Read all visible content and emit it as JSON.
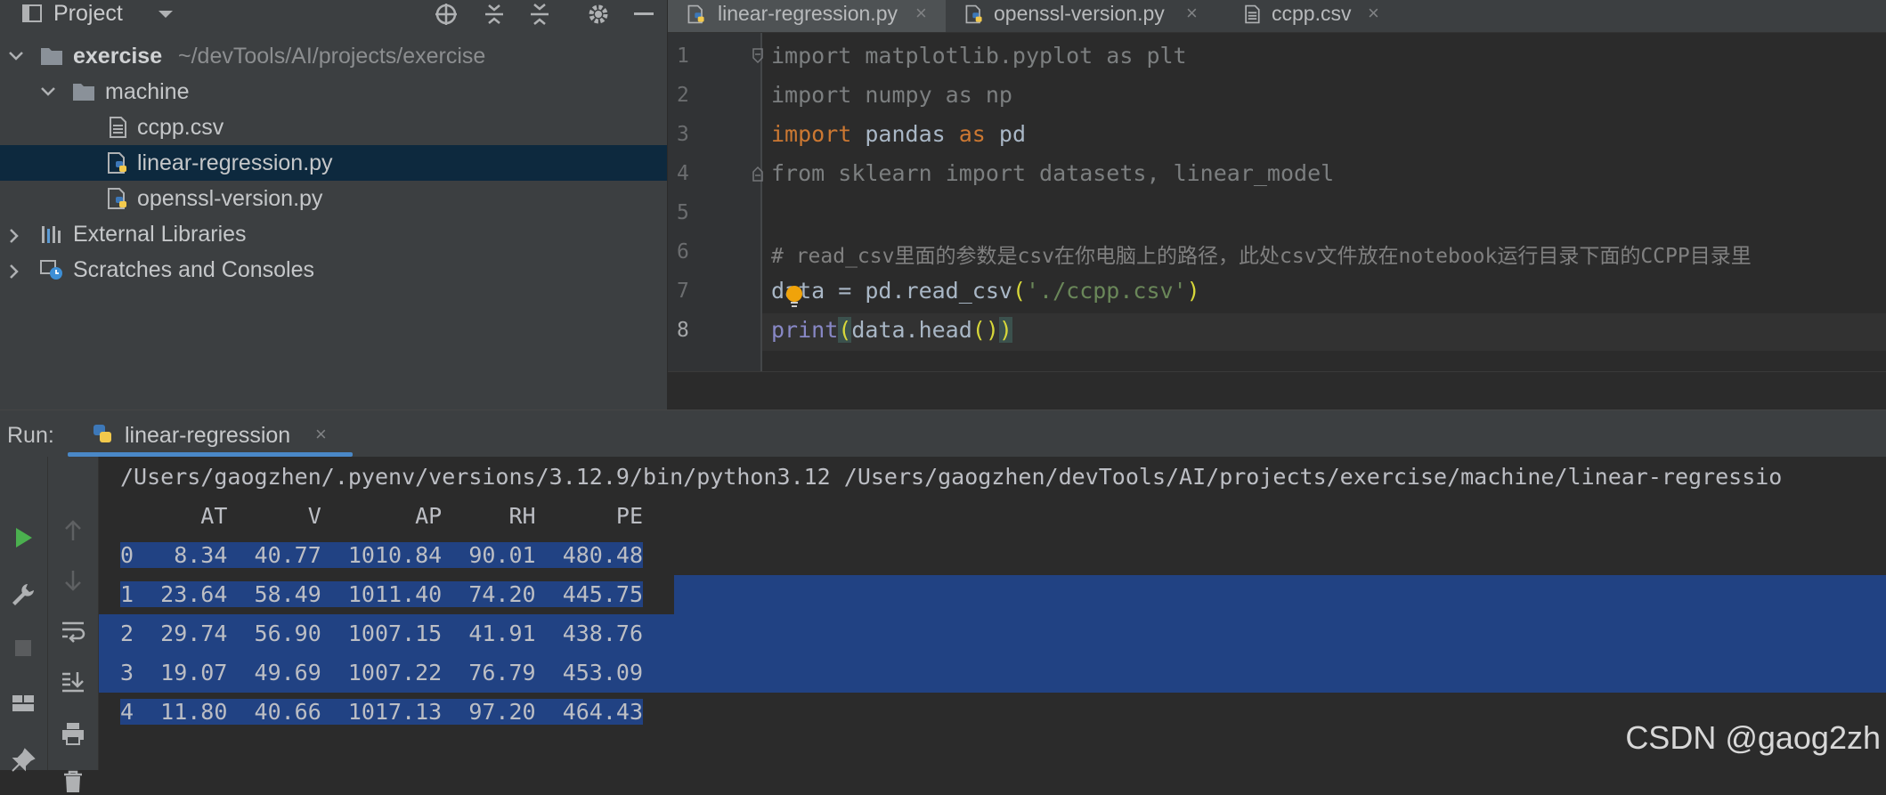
{
  "project": {
    "title": "Project",
    "tree": [
      {
        "label": "exercise",
        "path": "~/devTools/AI/projects/exercise"
      },
      {
        "label": "machine"
      },
      {
        "label": "ccpp.csv"
      },
      {
        "label": "linear-regression.py"
      },
      {
        "label": "openssl-version.py"
      },
      {
        "label": "External Libraries"
      },
      {
        "label": "Scratches and Consoles"
      }
    ]
  },
  "editor": {
    "tabs": [
      {
        "label": "linear-regression.py",
        "close": "×"
      },
      {
        "label": "openssl-version.py",
        "close": "×"
      },
      {
        "label": "ccpp.csv",
        "close": "×"
      }
    ],
    "line_numbers": [
      "1",
      "2",
      "3",
      "4",
      "5",
      "6",
      "7",
      "8"
    ],
    "code": {
      "l1_kw": "import",
      "l1_rest": " matplotlib.pyplot ",
      "l1_as": "as",
      "l1_alias": " plt",
      "l2_kw": "import",
      "l2_rest": " numpy ",
      "l2_as": "as",
      "l2_alias": " np",
      "l3_kw": "import",
      "l3_rest": " pandas ",
      "l3_as": "as",
      "l3_alias": " pd",
      "l4_kw": "from",
      "l4_mod": " sklearn ",
      "l4_imp": "import",
      "l4_rest": " datasets, linear_model",
      "l6": "# read_csv里面的参数是csv在你电脑上的路径，此处csv文件放在notebook运行目录下面的CCPP目录里",
      "l7_a": "data = pd.read_csv",
      "l7_open": "(",
      "l7_str": "'./ccpp.csv'",
      "l7_close": ")",
      "l8_fn": "print",
      "l8_open": "(",
      "l8_mid": "data.head",
      "l8_inner": "()",
      "l8_close": ")"
    }
  },
  "run": {
    "label": "Run:",
    "tab_label": "linear-regression",
    "tab_close": "×",
    "console": {
      "command": "/Users/gaogzhen/.pyenv/versions/3.12.9/bin/python3.12 /Users/gaogzhen/devTools/AI/projects/exercise/machine/linear-regressio",
      "header": "      AT      V       AP     RH      PE",
      "rows": [
        "0   8.34  40.77  1010.84  90.01  480.48",
        "1  23.64  58.49  1011.40  74.20  445.75",
        "2  29.74  56.90  1007.15  41.91  438.76",
        "3  19.07  49.69  1007.22  76.79  453.09",
        "4  11.80  40.66  1017.13  97.20  464.43"
      ]
    }
  },
  "watermark": "CSDN @gaog2zh",
  "colors": {
    "selection": "#214283",
    "tree_selection": "#0d293e",
    "keyword": "#cc7832",
    "string": "#6a8759",
    "run_icon": "#4bb04f"
  }
}
